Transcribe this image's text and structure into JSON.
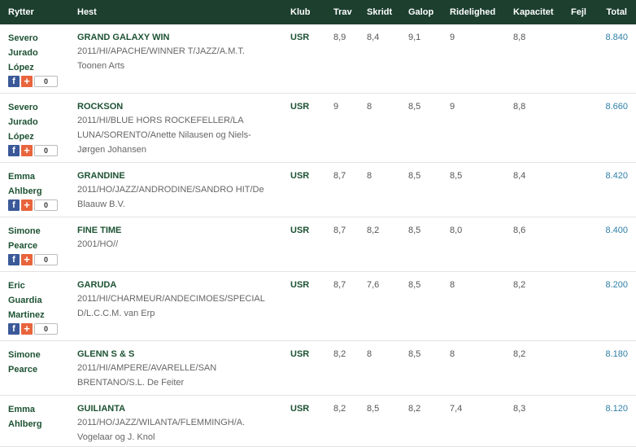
{
  "headers": {
    "rytter": "Rytter",
    "hest": "Hest",
    "klub": "Klub",
    "trav": "Trav",
    "skridt": "Skridt",
    "galop": "Galop",
    "ridelighed": "Ridelighed",
    "kapacitet": "Kapacitet",
    "fejl": "Fejl",
    "total": "Total"
  },
  "share": {
    "fb": "f",
    "plus": "+",
    "count": "0"
  },
  "rows": [
    {
      "rider": [
        "Severo",
        "Jurado",
        "López"
      ],
      "horse": "GRAND GALAXY WIN",
      "info": [
        "2011/HI/APACHE/WINNER T/JAZZ/A.M.T.",
        "Toonen Arts"
      ],
      "club": "USR",
      "trav": "8,9",
      "skridt": "8,4",
      "galop": "9,1",
      "ridelighed": "9",
      "kapacitet": "8,8",
      "fejl": "",
      "total": "8.840"
    },
    {
      "rider": [
        "Severo",
        "Jurado",
        "López"
      ],
      "horse": "ROCKSON",
      "info": [
        "2011/HI/BLUE HORS ROCKEFELLER/LA",
        "LUNA/SORENTO/Anette Nilausen og Niels-",
        "Jørgen Johansen"
      ],
      "club": "USR",
      "trav": "9",
      "skridt": "8",
      "galop": "8,5",
      "ridelighed": "9",
      "kapacitet": "8,8",
      "fejl": "",
      "total": "8.660"
    },
    {
      "rider": [
        "Emma",
        "Ahlberg"
      ],
      "horse": "GRANDINE",
      "info": [
        "2011/HO/JAZZ/ANDRODINE/SANDRO HIT/De",
        "Blaauw B.V."
      ],
      "club": "USR",
      "trav": "8,7",
      "skridt": "8",
      "galop": "8,5",
      "ridelighed": "8,5",
      "kapacitet": "8,4",
      "fejl": "",
      "total": "8.420"
    },
    {
      "rider": [
        "Simone",
        "Pearce"
      ],
      "horse": "FINE TIME",
      "info": [
        "2001/HO//"
      ],
      "club": "USR",
      "trav": "8,7",
      "skridt": "8,2",
      "galop": "8,5",
      "ridelighed": "8,0",
      "kapacitet": "8,6",
      "fejl": "",
      "total": "8.400"
    },
    {
      "rider": [
        "Eric",
        "Guardia",
        "Martinez"
      ],
      "horse": "GARUDA",
      "info": [
        "2011/HI/CHARMEUR/ANDECIMOES/SPECIAL",
        "D/L.C.C.M. van Erp"
      ],
      "club": "USR",
      "trav": "8,7",
      "skridt": "7,6",
      "galop": "8,5",
      "ridelighed": "8",
      "kapacitet": "8,2",
      "fejl": "",
      "total": "8.200"
    },
    {
      "rider": [
        "Simone",
        "Pearce"
      ],
      "horse": "GLENN S & S",
      "info": [
        "2011/HI/AMPERE/AVARELLE/SAN",
        "BRENTANO/S.L. De Feiter"
      ],
      "club": "USR",
      "trav": "8,2",
      "skridt": "8",
      "galop": "8,5",
      "ridelighed": "8",
      "kapacitet": "8,2",
      "fejl": "",
      "total": "8.180"
    },
    {
      "rider": [
        "Emma",
        "Ahlberg"
      ],
      "horse": "GUILIANTA",
      "info": [
        "2011/HO/JAZZ/WILANTA/FLEMMINGH/A.",
        "Vogelaar og J. Knol"
      ],
      "club": "USR",
      "trav": "8,2",
      "skridt": "8,5",
      "galop": "8,2",
      "ridelighed": "7,4",
      "kapacitet": "8,3",
      "fejl": "",
      "total": "8.120"
    }
  ]
}
